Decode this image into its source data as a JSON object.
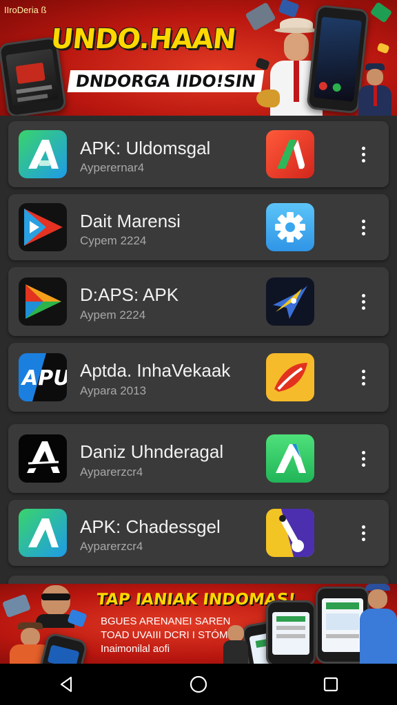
{
  "top_banner": {
    "brand": "IIroDeria ß",
    "headline": "UNDO.HAAN",
    "subheadline": "DNDORGA IIDO!SIN"
  },
  "apps": [
    {
      "title": "APK: Uldomsgal",
      "subtitle": "Ayperernar4",
      "left_icon": "green-a-logo-icon",
      "right_icon": "red-a-logo-icon"
    },
    {
      "title": "Dait Marensi",
      "subtitle": "Cypem 2224",
      "left_icon": "play-triangle-icon",
      "right_icon": "gear-icon"
    },
    {
      "title": "D:APS: APK",
      "subtitle": "Aypem 2224",
      "left_icon": "google-play-icon",
      "right_icon": "compass-star-icon"
    },
    {
      "title": "Aptda. InhaVekaak",
      "subtitle": "Aypara 2013",
      "left_icon": "apu-logo-icon",
      "right_icon": "leaf-swoosh-icon"
    },
    {
      "title": "Daniz Uhnderagal",
      "subtitle": "Ayparerzcr4",
      "left_icon": "black-a-logo-icon",
      "right_icon": "green-a-logo-icon"
    },
    {
      "title": "APK: Chadessgel",
      "subtitle": "Ayparerzcr4",
      "left_icon": "green-a-logo-icon",
      "right_icon": "thermometer-icon"
    }
  ],
  "bottom_banner": {
    "headline": "TAP IANIAK INDOMAS!",
    "lines": [
      "BGUES ARENANEI SAREN",
      "TOAD UVAIII DCRI I STÓM",
      "Inaimonilal aofi"
    ]
  },
  "nav": {
    "back": "back-icon",
    "home": "home-icon",
    "recents": "recents-icon"
  },
  "colors": {
    "banner_red": "#c51d13",
    "headline_yellow": "#ffd800",
    "card_bg": "#3a3a3a",
    "page_bg": "#2b2b2b"
  }
}
